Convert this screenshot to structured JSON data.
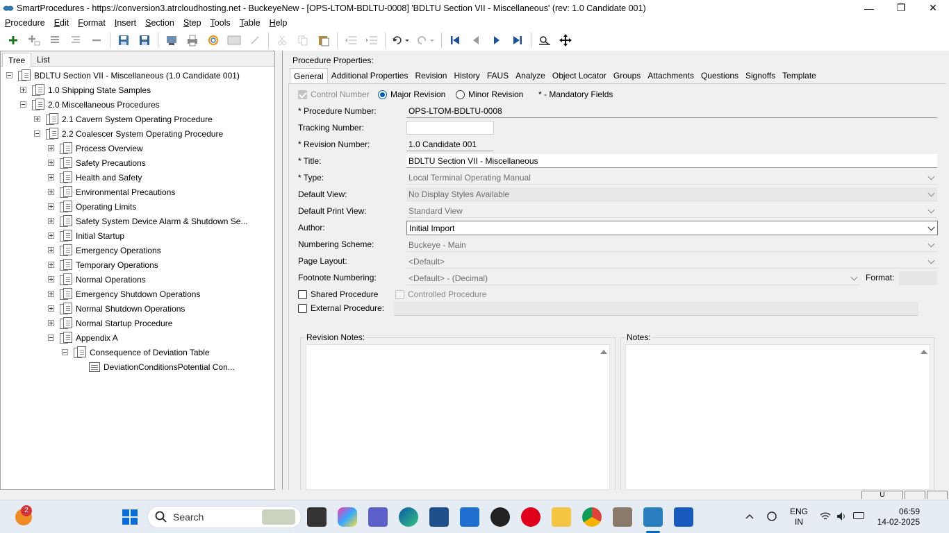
{
  "window": {
    "title": "SmartProcedures - https://conversion3.atrcloudhosting.net - BuckeyeNew - [OPS-LTOM-BDLTU-0008] 'BDLTU Section VII - Miscellaneous' (rev: 1.0 Candidate 001)",
    "minimize": "—",
    "maximize": "❐",
    "close": "✕"
  },
  "menu": {
    "items": [
      {
        "u": "P",
        "rest": "rocedure"
      },
      {
        "u": "E",
        "rest": "dit"
      },
      {
        "u": "F",
        "rest": "ormat"
      },
      {
        "u": "I",
        "rest": "nsert"
      },
      {
        "u": "S",
        "rest": "ection"
      },
      {
        "u": "S",
        "rest": "tep"
      },
      {
        "u": "T",
        "rest": "ools"
      },
      {
        "u": "T",
        "rest": "able"
      },
      {
        "u": "H",
        "rest": "elp"
      }
    ]
  },
  "left_tabs": {
    "tree": "Tree",
    "list": "List"
  },
  "tree": {
    "nodes": [
      {
        "label": "BDLTU Section VII - Miscellaneous (1.0 Candidate 001)"
      },
      {
        "label": "1.0 Shipping State Samples"
      },
      {
        "label": "2.0 Miscellaneous Procedures"
      },
      {
        "label": "2.1 Cavern System Operating Procedure"
      },
      {
        "label": "2.2 Coalescer System Operating Procedure"
      },
      {
        "label": "Process Overview"
      },
      {
        "label": "Safety Precautions"
      },
      {
        "label": "Health and Safety"
      },
      {
        "label": "Environmental Precautions"
      },
      {
        "label": "Operating Limits"
      },
      {
        "label": "Safety System Device Alarm & Shutdown Se..."
      },
      {
        "label": "Initial Startup"
      },
      {
        "label": "Emergency Operations"
      },
      {
        "label": "Temporary Operations"
      },
      {
        "label": "Normal Operations"
      },
      {
        "label": "Emergency Shutdown Operations"
      },
      {
        "label": "Normal Shutdown Operations"
      },
      {
        "label": "Normal Startup Procedure"
      },
      {
        "label": "Appendix A"
      },
      {
        "label": "Consequence of Deviation Table"
      },
      {
        "label": "DeviationConditionsPotential Con..."
      }
    ]
  },
  "properties": {
    "heading": "Procedure Properties:",
    "tabs": [
      "General",
      "Additional Properties",
      "Revision",
      "History",
      "FAUS",
      "Analyze",
      "Object Locator",
      "Groups",
      "Attachments",
      "Questions",
      "Signoffs",
      "Template"
    ],
    "control_number": "Control Number",
    "major_revision": "Major Revision",
    "minor_revision": "Minor Revision",
    "mandatory": "* - Mandatory Fields",
    "procedure_number_label": "* Procedure Number:",
    "procedure_number": "OPS-LTOM-BDLTU-0008",
    "tracking_number_label": "Tracking Number:",
    "tracking_number": "",
    "revision_number_label": "* Revision Number:",
    "revision_number": "1.0 Candidate 001",
    "title_label": "* Title:",
    "title": "BDLTU Section VII - Miscellaneous",
    "type_label": "* Type:",
    "type": "Local Terminal Operating Manual",
    "default_view_label": "Default View:",
    "default_view": "No Display Styles Available",
    "default_print_view_label": "Default Print View:",
    "default_print_view": "Standard View",
    "author_label": "Author:",
    "author": "Initial Import",
    "numbering_scheme_label": "Numbering Scheme:",
    "numbering_scheme": "Buckeye - Main",
    "page_layout_label": "Page Layout:",
    "page_layout": "<Default>",
    "footnote_numbering_label": "Footnote Numbering:",
    "footnote_numbering": "<Default> - (Decimal)",
    "format_label": "Format:",
    "shared_procedure": "Shared Procedure",
    "controlled_procedure": "Controlled Procedure",
    "external_procedure_label": "External Procedure:",
    "revision_notes": "Revision Notes:",
    "notes": "Notes:"
  },
  "statusbar": {
    "pane1": "U"
  },
  "taskbar": {
    "search": "Search",
    "notification_count": "2",
    "lang": "ENG",
    "region": "IN",
    "time": "06:59",
    "date": "14-02-2025"
  },
  "colors": {
    "accent": "#005fb8",
    "taskbar": "#e6ecf4"
  }
}
